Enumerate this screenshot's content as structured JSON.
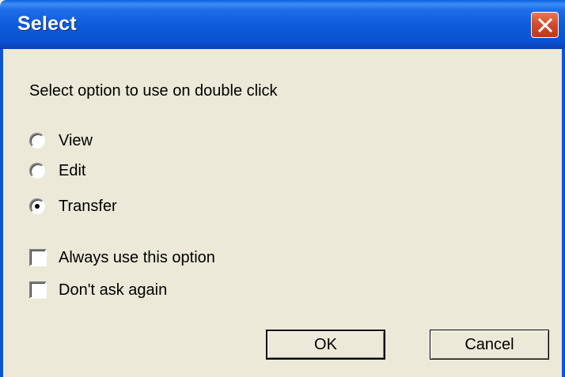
{
  "dialog": {
    "title": "Select",
    "prompt": "Select option to use on double click",
    "options": [
      {
        "label": "View",
        "selected": false
      },
      {
        "label": "Edit",
        "selected": false
      },
      {
        "label": "Transfer",
        "selected": true
      }
    ],
    "checkboxes": [
      {
        "label": "Always use this option",
        "checked": false
      },
      {
        "label": "Don't ask again",
        "checked": false
      }
    ],
    "buttons": {
      "ok": "OK",
      "cancel": "Cancel"
    }
  },
  "colors": {
    "title_bar": "#0b5ad9",
    "close_button": "#d2492b",
    "dialog_background": "#ece9d8"
  },
  "icons": {
    "close": "close-icon"
  }
}
